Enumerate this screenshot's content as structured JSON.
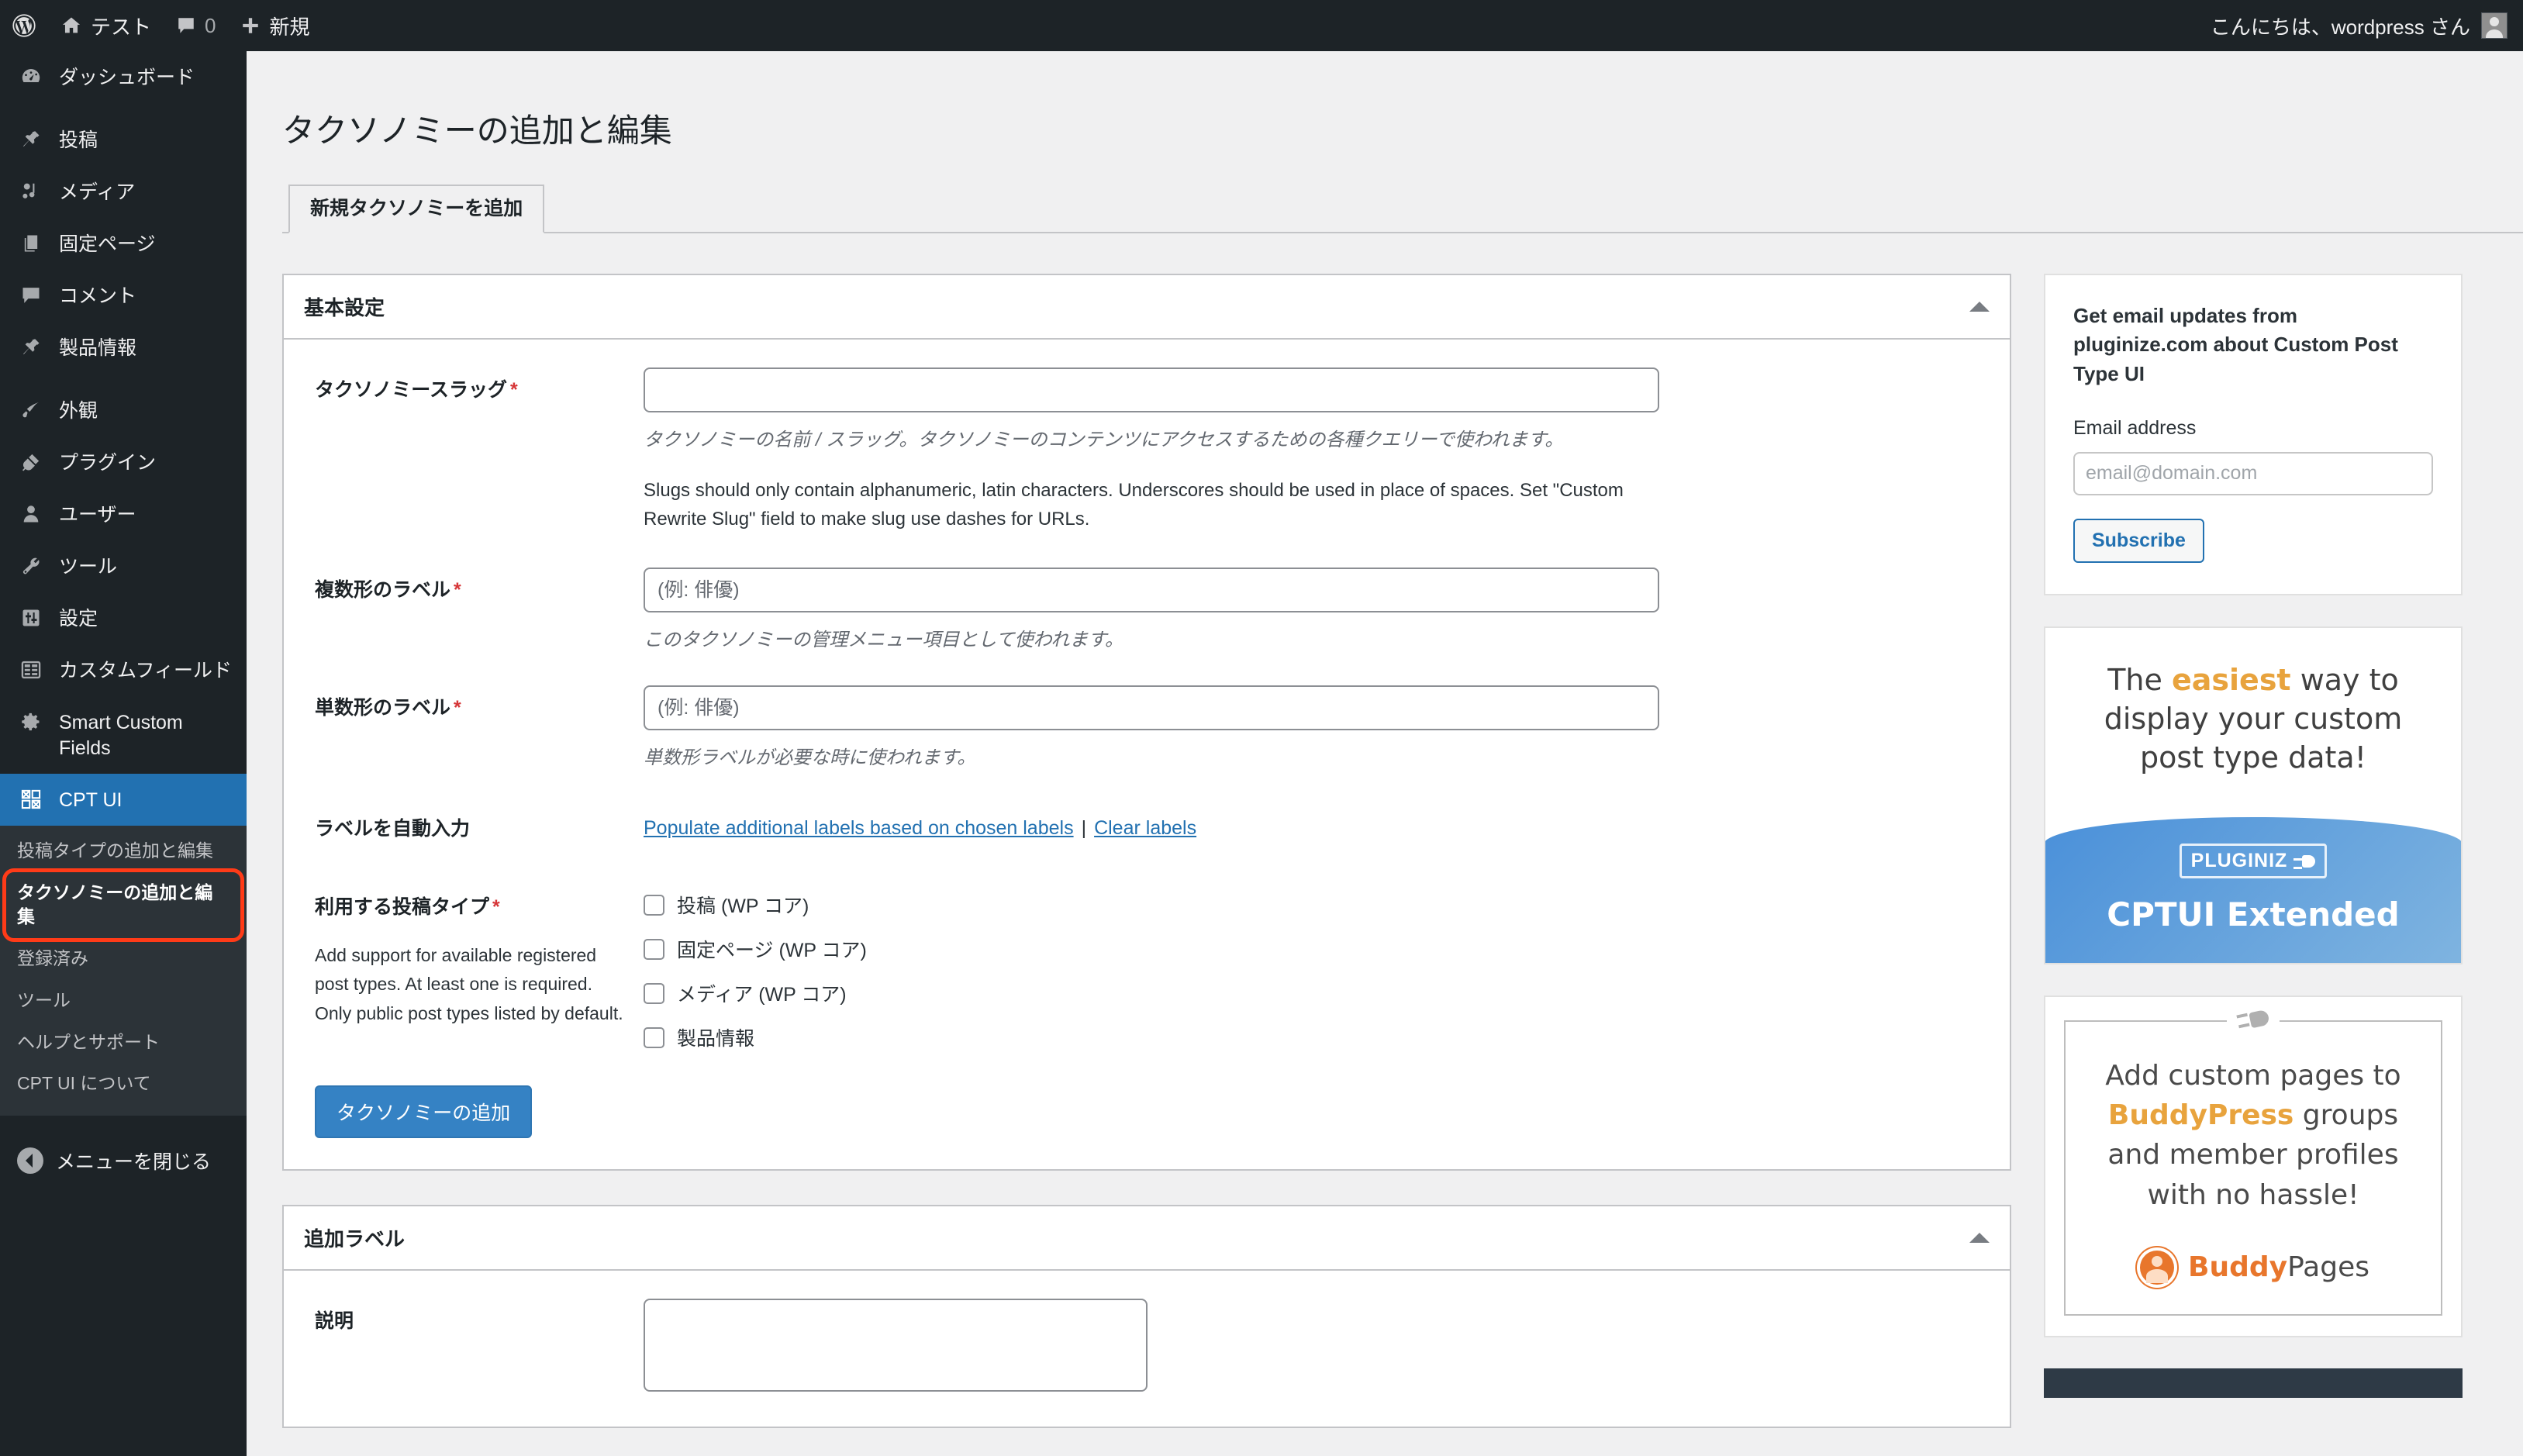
{
  "adminbar": {
    "site_name": "テスト",
    "comment_count": "0",
    "new_label": "新規",
    "greeting": "こんにちは、wordpress さん",
    "icons": {
      "wordpress": "wordpress-logo-icon",
      "home": "home-icon",
      "comment": "comment-bubble-icon",
      "plus": "plus-icon",
      "avatar": "user-avatar"
    }
  },
  "sidebar": {
    "items": [
      {
        "label": "ダッシュボード",
        "icon": "dashboard-icon"
      },
      {
        "label": "投稿",
        "icon": "pin-icon"
      },
      {
        "label": "メディア",
        "icon": "media-icon"
      },
      {
        "label": "固定ページ",
        "icon": "pages-icon"
      },
      {
        "label": "コメント",
        "icon": "comment-bubble-icon"
      },
      {
        "label": "製品情報",
        "icon": "pin-icon"
      },
      {
        "label": "外観",
        "icon": "paintbrush-icon"
      },
      {
        "label": "プラグイン",
        "icon": "plug-icon"
      },
      {
        "label": "ユーザー",
        "icon": "user-icon"
      },
      {
        "label": "ツール",
        "icon": "wrench-icon"
      },
      {
        "label": "設定",
        "icon": "settings-sliders-icon"
      },
      {
        "label": "カスタムフィールド",
        "icon": "custom-fields-icon"
      },
      {
        "label": "Smart Custom Fields",
        "icon": "gear-icon"
      },
      {
        "label": "CPT UI",
        "icon": "cptui-grid-icon"
      }
    ],
    "submenu": [
      {
        "label": "投稿タイプの追加と編集",
        "state": "normal"
      },
      {
        "label": "タクソノミーの追加と編集",
        "state": "active-highlighted"
      },
      {
        "label": "登録済み",
        "state": "normal"
      },
      {
        "label": "ツール",
        "state": "normal"
      },
      {
        "label": "ヘルプとサポート",
        "state": "normal"
      },
      {
        "label": "CPT UI について",
        "state": "normal"
      }
    ],
    "collapse_label": "メニューを閉じる",
    "highlight_color": "#ff3b18",
    "current_color": "#2271b1"
  },
  "page": {
    "title": "タクソノミーの追加と編集",
    "tab_label": "新規タクソノミーを追加"
  },
  "basic_panel": {
    "title": "基本設定",
    "slug": {
      "label": "タクソノミースラッグ",
      "required": "*",
      "value": "",
      "placeholder": "",
      "desc_ja": "タクソノミーの名前 / スラッグ。タクソノミーのコンテンツにアクセスするための各種クエリーで使われます。",
      "desc_en": "Slugs should only contain alphanumeric, latin characters. Underscores should be used in place of spaces. Set \"Custom Rewrite Slug\" field to make slug use dashes for URLs."
    },
    "plural": {
      "label": "複数形のラベル",
      "required": "*",
      "value": "",
      "placeholder": "(例: 俳優)",
      "desc": "このタクソノミーの管理メニュー項目として使われます。"
    },
    "singular": {
      "label": "単数形のラベル",
      "required": "*",
      "value": "",
      "placeholder": "(例: 俳優)",
      "desc": "単数形ラベルが必要な時に使われます。"
    },
    "autofill": {
      "label": "ラベルを自動入力",
      "populate_link": "Populate additional labels based on chosen labels",
      "separator": "|",
      "clear_link": "Clear labels"
    },
    "post_types": {
      "label": "利用する投稿タイプ",
      "required": "*",
      "desc": "Add support for available registered post types. At least one is required. Only public post types listed by default.",
      "options": [
        {
          "label": "投稿 (WP コア)",
          "checked": false
        },
        {
          "label": "固定ページ (WP コア)",
          "checked": false
        },
        {
          "label": "メディア (WP コア)",
          "checked": false
        },
        {
          "label": "製品情報",
          "checked": false
        }
      ]
    },
    "submit_label": "タクソノミーの追加"
  },
  "extra_panel": {
    "title": "追加ラベル",
    "description": {
      "label": "説明",
      "value": ""
    }
  },
  "side": {
    "subscribe": {
      "title": "Get email updates from pluginize.com about Custom Post Type UI",
      "email_label": "Email address",
      "email_value": "",
      "email_placeholder": "email@domain.com",
      "button_label": "Subscribe"
    },
    "ad_cptui": {
      "line1_a": "The ",
      "line1_b": "easiest",
      "line1_c": " way to",
      "line2": "display your custom",
      "line3": "post type data!",
      "badge": "PLUGINIZ",
      "name": "CPTUI Extended"
    },
    "ad_buddy": {
      "line1": "Add custom pages to",
      "brand_inline": "BuddyPress",
      "line2_tail": " groups",
      "line3": "and member profiles",
      "line4": "with no hassle!",
      "brand_a": "Buddy",
      "brand_b": "Pages"
    }
  }
}
